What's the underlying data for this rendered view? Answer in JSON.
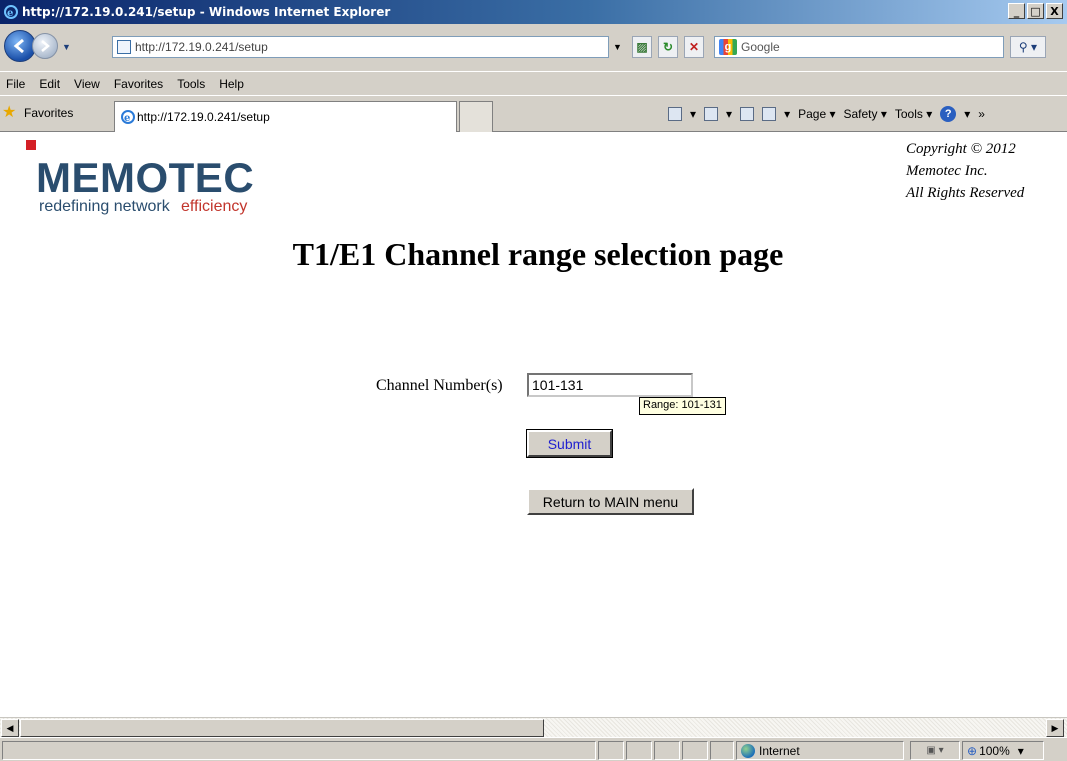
{
  "window": {
    "title": "http://172.19.0.241/setup - Windows Internet Explorer",
    "minimize": "_",
    "maximize": "□",
    "close": "X"
  },
  "address_bar": {
    "url": "http://172.19.0.241/setup",
    "search_placeholder": "Google"
  },
  "menu": {
    "items": [
      "File",
      "Edit",
      "View",
      "Favorites",
      "Tools",
      "Help"
    ]
  },
  "favorites_bar": {
    "favorites_label": "Favorites",
    "tab_title": "http://172.19.0.241/setup",
    "commands": [
      "Page",
      "Safety",
      "Tools"
    ]
  },
  "page": {
    "logo_word": "MEMOTEC",
    "logo_tagline_part1": "redefining network",
    "logo_tagline_part2": "efficiency",
    "copyright_line1": "Copyright © 2012",
    "copyright_line2": "Memotec Inc.",
    "copyright_line3": "All Rights Reserved",
    "title": "T1/E1 Channel range selection page",
    "channel_label": "Channel Number(s)",
    "channel_value": "101-131",
    "tooltip": "Range: 101-131",
    "submit_label": "Submit",
    "return_label": "Return to MAIN menu"
  },
  "status_bar": {
    "zone": "Internet",
    "zoom": "100%"
  },
  "colors": {
    "logo_blue": "#2a4d6e",
    "logo_red": "#d41f26",
    "submit_text": "#1f1fd0"
  }
}
